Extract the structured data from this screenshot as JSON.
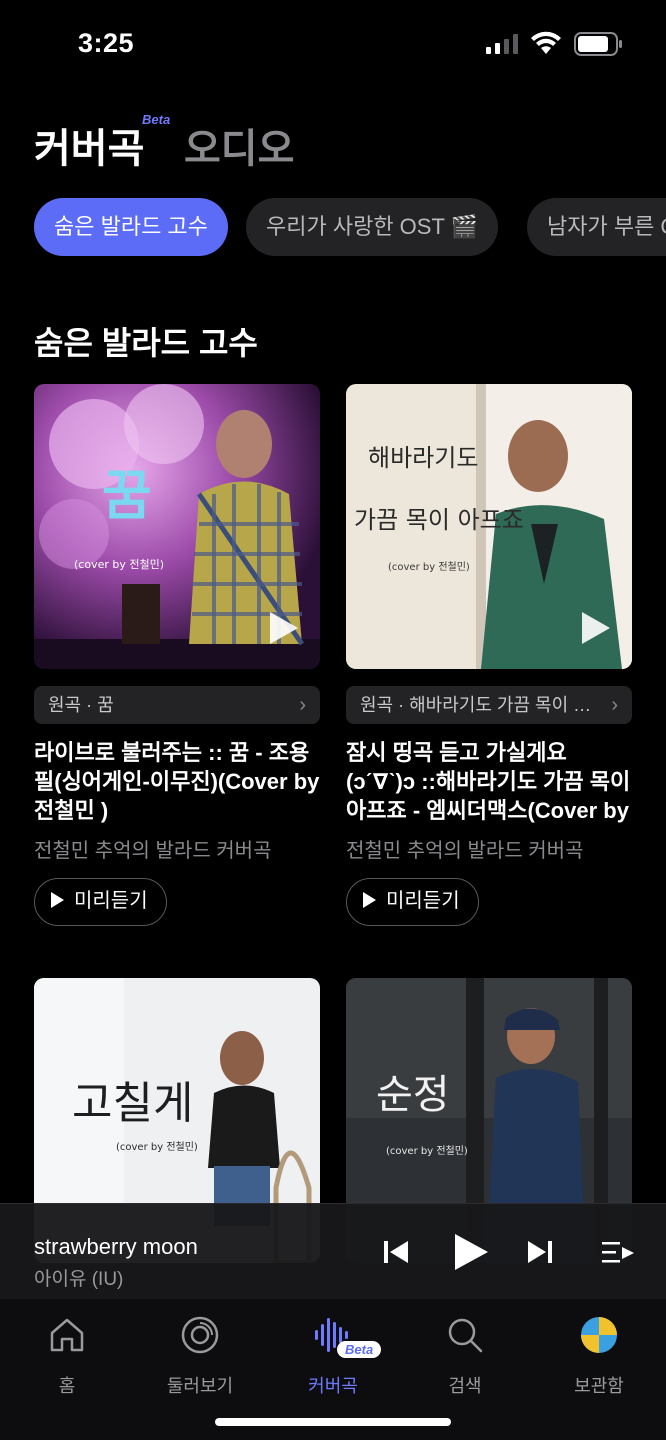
{
  "status": {
    "time": "3:25"
  },
  "header": {
    "covers_tab": "커버곡",
    "beta": "Beta",
    "audio_tab": "오디오"
  },
  "chips": [
    {
      "label": "숨은 발라드 고수",
      "active": true
    },
    {
      "label": "우리가 사랑한 OST 🎬",
      "active": false
    },
    {
      "label": "남자가 부른 Cover",
      "active": false
    }
  ],
  "section": {
    "title": "숨은 발라드 고수"
  },
  "cards": [
    {
      "origin": "원곡 · 꿈",
      "title": "라이브로 불러주는 :: 꿈 - 조용필(싱어게인-이무진)(Cover by전철민 )",
      "subtitle": "전철민 추억의 발라드 커버곡",
      "preview": "미리듣기",
      "thumb_text": "꿈",
      "thumb_caption": "(cover by 전철민)"
    },
    {
      "origin": "원곡 · 해바라기도 가끔 목이 아프죠",
      "title": "잠시 띵곡 듣고 가실게요 (ɔˊ∇ˋ)ɔ ::해바라기도 가끔 목이 아프죠 - 엠씨더맥스(Cover by전철민)",
      "subtitle": "전철민 추억의 발라드 커버곡",
      "preview": "미리듣기",
      "thumb_text1": "해바라기도",
      "thumb_text2": "가끔 목이 아프죠",
      "thumb_caption": "(cover by 전철민)"
    },
    {
      "thumb_text": "고칠게",
      "thumb_caption": "(cover by 전철민)"
    },
    {
      "thumb_text": "순정",
      "thumb_caption": "(cover by 전철민)"
    }
  ],
  "player": {
    "song": "strawberry moon",
    "artist": "아이유 (IU)"
  },
  "tabbar": [
    {
      "label": "홈",
      "icon": "home-icon"
    },
    {
      "label": "둘러보기",
      "icon": "explore-disc-icon"
    },
    {
      "label": "커버곡",
      "icon": "soundwave-icon",
      "badge": "Beta"
    },
    {
      "label": "검색",
      "icon": "search-icon"
    },
    {
      "label": "보관함",
      "icon": "library-avatar-icon"
    }
  ],
  "colors": {
    "accent": "#5d6cf6",
    "background": "#000000",
    "chip": "#232325"
  }
}
